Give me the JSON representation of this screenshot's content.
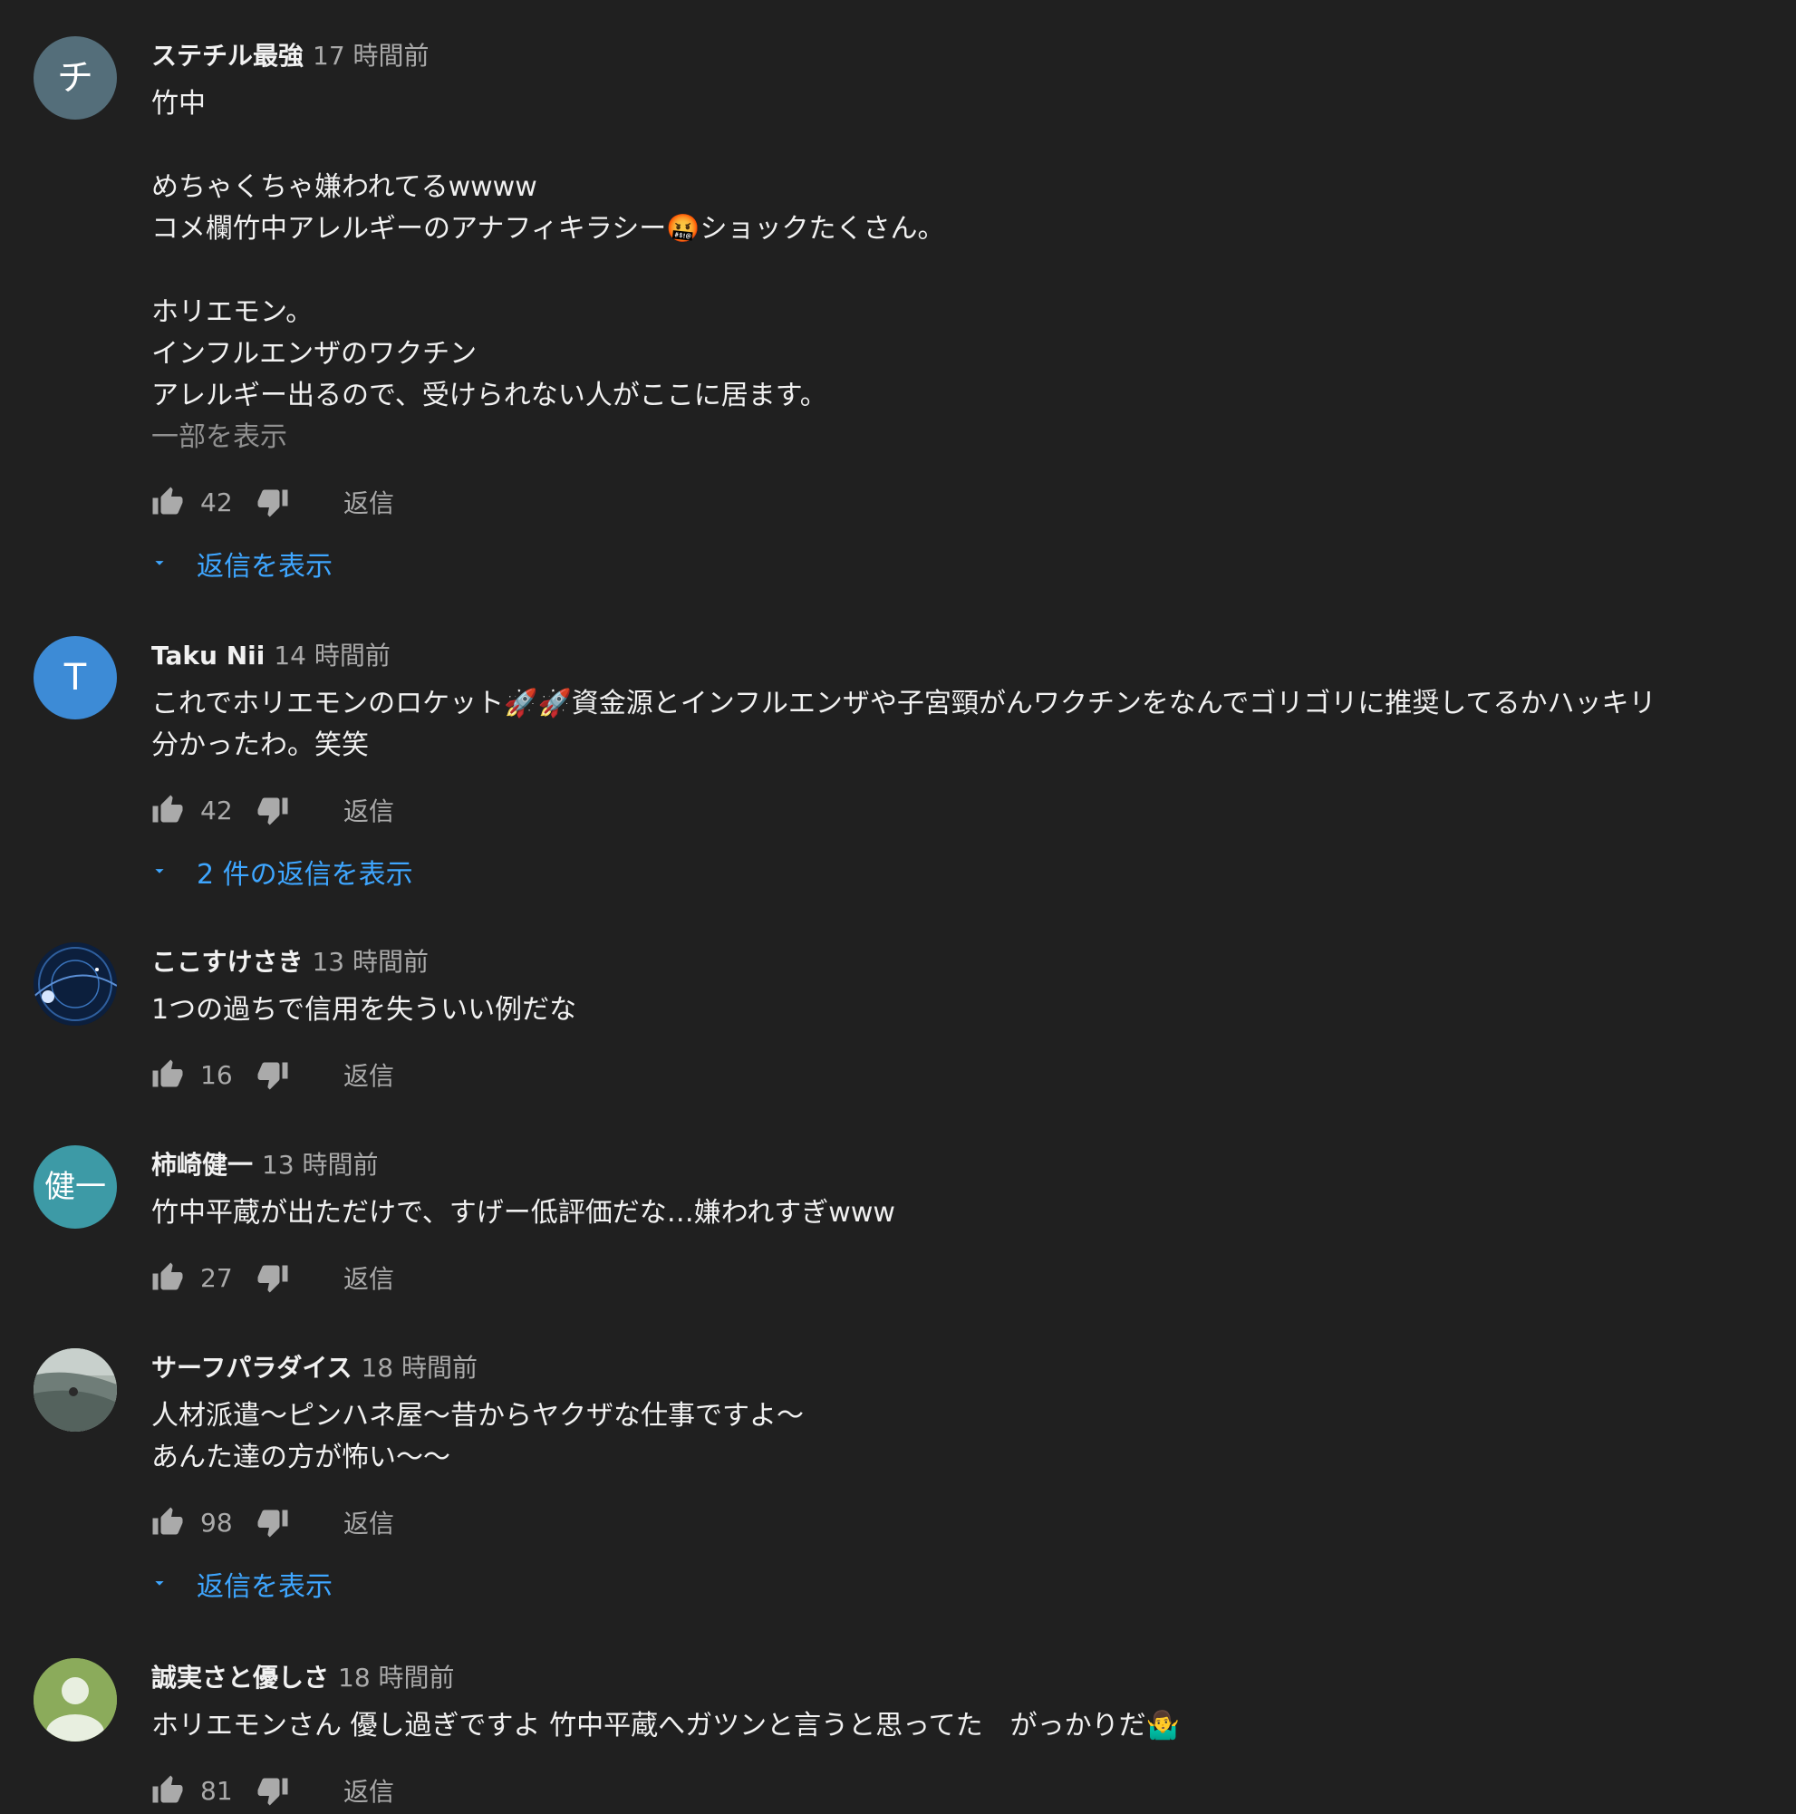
{
  "colors": {
    "background": "#202020",
    "text": "#f1f1f1",
    "secondary": "#aaaaaa",
    "link": "#3ea6ff"
  },
  "reply_label": "返信",
  "comments": [
    {
      "author": "ステチル最強",
      "time": "17 時間前",
      "avatar": {
        "initial": "チ",
        "color": "#546e7a"
      },
      "lines": [
        "竹中",
        "",
        "めちゃくちゃ嫌われてるwwww",
        "コメ欄竹中アレルギーのアナフィキラシー🤬ショックたくさん。",
        "",
        "ホリエモン。",
        "インフルエンザのワクチン",
        "アレルギー出るので、受けられない人がここに居ます。"
      ],
      "read_more": "一部を表示",
      "likes": "42",
      "view_replies": "返信を表示"
    },
    {
      "author": "Taku Nii",
      "time": "14 時間前",
      "avatar": {
        "initial": "T",
        "color": "#3d8bd6"
      },
      "lines": [
        "これでホリエモンのロケット🚀🚀資金源とインフルエンザや子宮頸がんワクチンをなんでゴリゴリに推奨してるかハッキリ",
        "分かったわ。笑笑"
      ],
      "likes": "42",
      "view_replies": "2 件の返信を表示"
    },
    {
      "author": "ここすけさき",
      "time": "13 時間前",
      "avatar": {
        "initial": "",
        "color": "#0c1f3d",
        "type": "photo-blue"
      },
      "lines": [
        "1つの過ちで信用を失ういい例だな"
      ],
      "likes": "16"
    },
    {
      "author": "柿崎健一",
      "time": "13 時間前",
      "avatar": {
        "initial": "健一",
        "color": "#3d9aa6"
      },
      "lines": [
        "竹中平蔵が出ただけで、すげー低評価だな…嫌われすぎwww"
      ],
      "likes": "27"
    },
    {
      "author": "サーフパラダイス",
      "time": "18 時間前",
      "avatar": {
        "initial": "",
        "color": "#8a9490",
        "type": "photo-wave"
      },
      "lines": [
        "人材派遣〜ピンハネ屋〜昔からヤクザな仕事ですよ〜",
        "あんた達の方が怖い〜〜"
      ],
      "likes": "98",
      "view_replies": "返信を表示"
    },
    {
      "author": "誠実さと優しさ",
      "time": "18 時間前",
      "avatar": {
        "initial": "",
        "color": "#8bab5b",
        "type": "default-person"
      },
      "lines": [
        "ホリエモンさん 優し過ぎですよ 竹中平蔵へガツンと言うと思ってた　がっかりだ🤷‍♂️"
      ],
      "likes": "81"
    }
  ]
}
